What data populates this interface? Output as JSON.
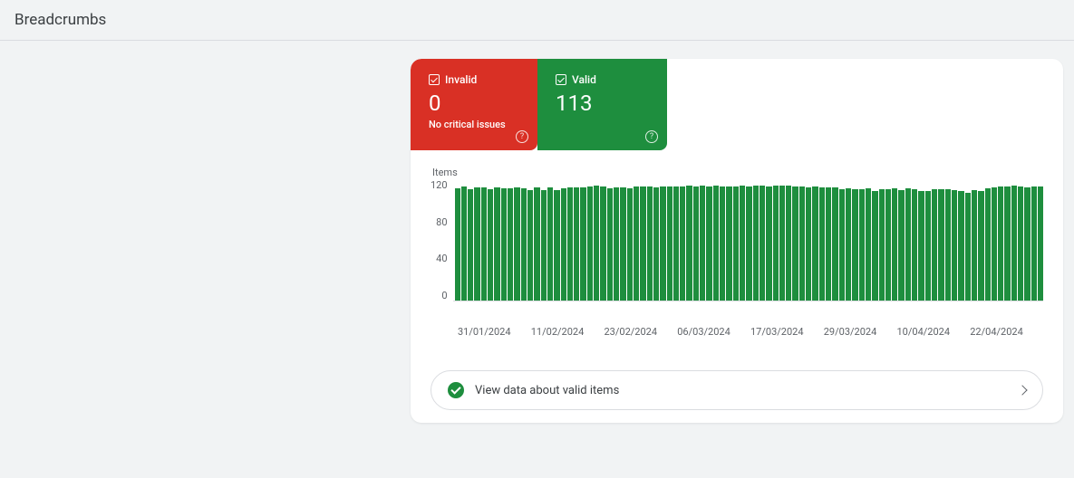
{
  "header": {
    "title": "Breadcrumbs"
  },
  "tabs": {
    "invalid": {
      "label": "Invalid",
      "count": "0",
      "sub": "No critical issues"
    },
    "valid": {
      "label": "Valid",
      "count": "113"
    }
  },
  "chart_data": {
    "type": "bar",
    "title": "Items",
    "ylabel": "Items",
    "ylim": [
      0,
      120
    ],
    "y_ticks": [
      "120",
      "80",
      "40",
      "0"
    ],
    "x_ticks": [
      "31/01/2024",
      "11/02/2024",
      "23/02/2024",
      "06/03/2024",
      "17/03/2024",
      "29/03/2024",
      "10/04/2024",
      "22/04/2024"
    ],
    "values": [
      111,
      113,
      110,
      112,
      112,
      110,
      112,
      111,
      111,
      112,
      111,
      109,
      112,
      109,
      112,
      109,
      111,
      112,
      112,
      112,
      113,
      114,
      113,
      111,
      112,
      112,
      111,
      113,
      113,
      113,
      112,
      113,
      113,
      113,
      113,
      114,
      113,
      114,
      113,
      114,
      113,
      113,
      113,
      114,
      113,
      114,
      114,
      113,
      114,
      114,
      114,
      113,
      113,
      112,
      113,
      112,
      112,
      112,
      110,
      111,
      110,
      110,
      111,
      108,
      110,
      110,
      111,
      109,
      111,
      110,
      108,
      108,
      110,
      110,
      110,
      109,
      108,
      107,
      109,
      108,
      111,
      112,
      113,
      113,
      114,
      113,
      112,
      113,
      113
    ]
  },
  "link_row": {
    "text": "View data about valid items"
  }
}
